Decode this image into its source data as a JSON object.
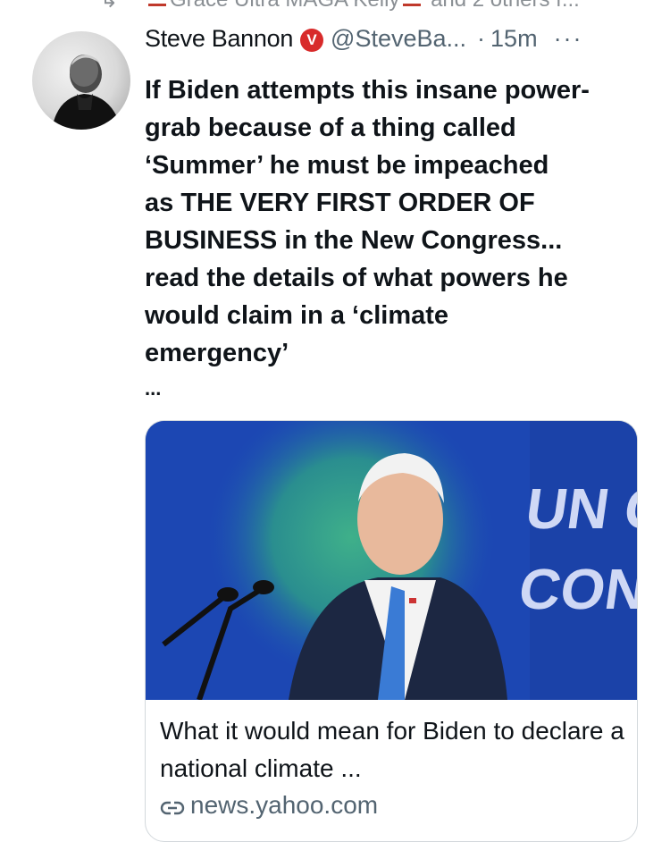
{
  "social_context": {
    "names": "Grace Ultra MAGA Kelly",
    "suffix": "and 2 others f..."
  },
  "tweet": {
    "author_name": "Steve Bannon",
    "verified_badge_letter": "V",
    "handle": "@SteveBa...",
    "separator": "·",
    "time": "15m",
    "more_glyph": "···",
    "text": "If Biden attempts this insane power-\ngrab  because of a thing called\n‘Summer’  he must be impeached\nas THE VERY FIRST ORDER OF\nBUSINESS in the New Congress...\nread the details of what powers he\nwould claim in a ‘climate\nemergency’",
    "text_ellipsis": "..."
  },
  "card": {
    "image_sign_text_1": "UN C",
    "image_sign_text_2": "CONF",
    "title": "What it would mean for Biden to declare a national climate ...",
    "domain": "news.yahoo.com",
    "link_icon": "link-icon"
  },
  "colors": {
    "text_primary": "#0f1419",
    "text_secondary": "#536471",
    "badge_red": "#d82a2a",
    "card_border": "#d3d8dc"
  }
}
